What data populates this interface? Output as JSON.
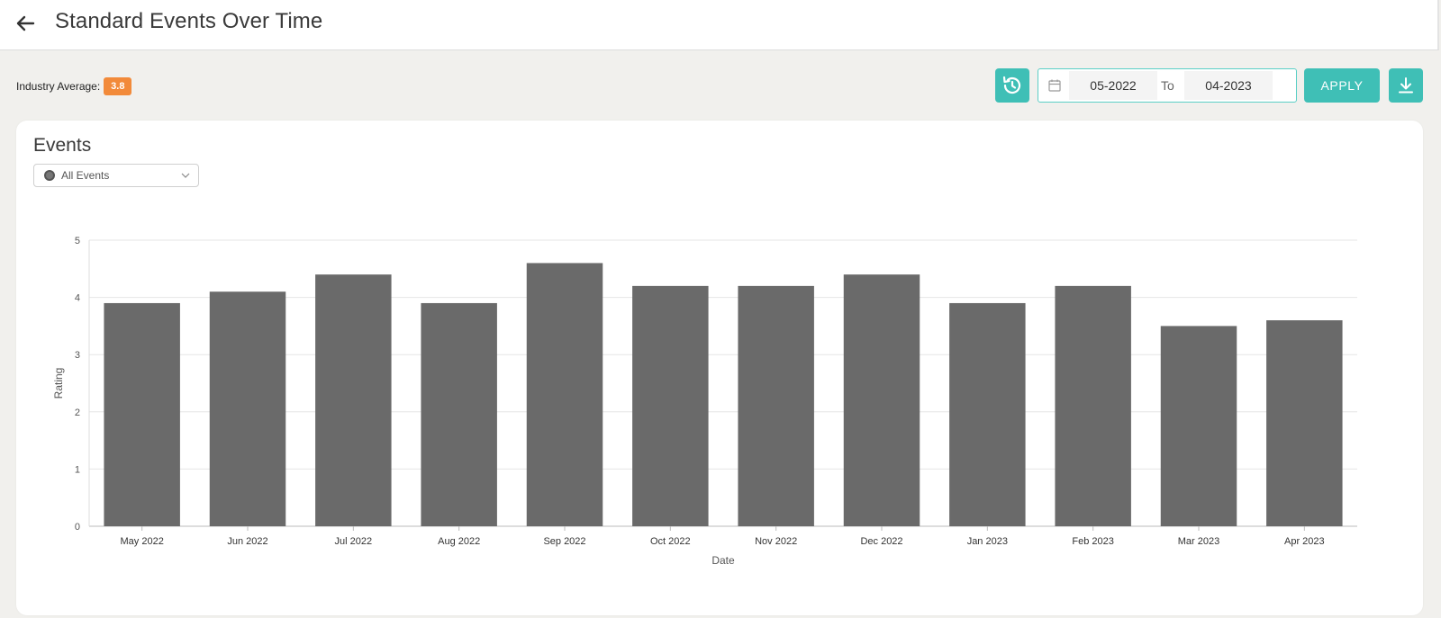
{
  "header": {
    "title": "Standard Events Over Time"
  },
  "toolbar": {
    "industry_label": "Industry Average:",
    "industry_value": "3.8",
    "date_from": "05-2022",
    "to_label": "To",
    "date_to": "04-2023",
    "apply_label": "APPLY"
  },
  "card": {
    "title": "Events",
    "select_value": "All Events"
  },
  "colors": {
    "accent": "#3fbfb6",
    "badge": "#f28a3a",
    "bar": "#6a6a6a"
  },
  "chart_data": {
    "type": "bar",
    "categories": [
      "May 2022",
      "Jun 2022",
      "Jul 2022",
      "Aug 2022",
      "Sep 2022",
      "Oct 2022",
      "Nov 2022",
      "Dec 2022",
      "Jan 2023",
      "Feb 2023",
      "Mar 2023",
      "Apr 2023"
    ],
    "values": [
      3.9,
      4.1,
      4.4,
      3.9,
      4.6,
      4.2,
      4.2,
      4.4,
      3.9,
      4.2,
      3.5,
      3.6
    ],
    "xlabel": "Date",
    "ylabel": "Rating",
    "ylim": [
      0,
      5
    ],
    "yticks": [
      0,
      1,
      2,
      3,
      4,
      5
    ],
    "grid": true
  }
}
